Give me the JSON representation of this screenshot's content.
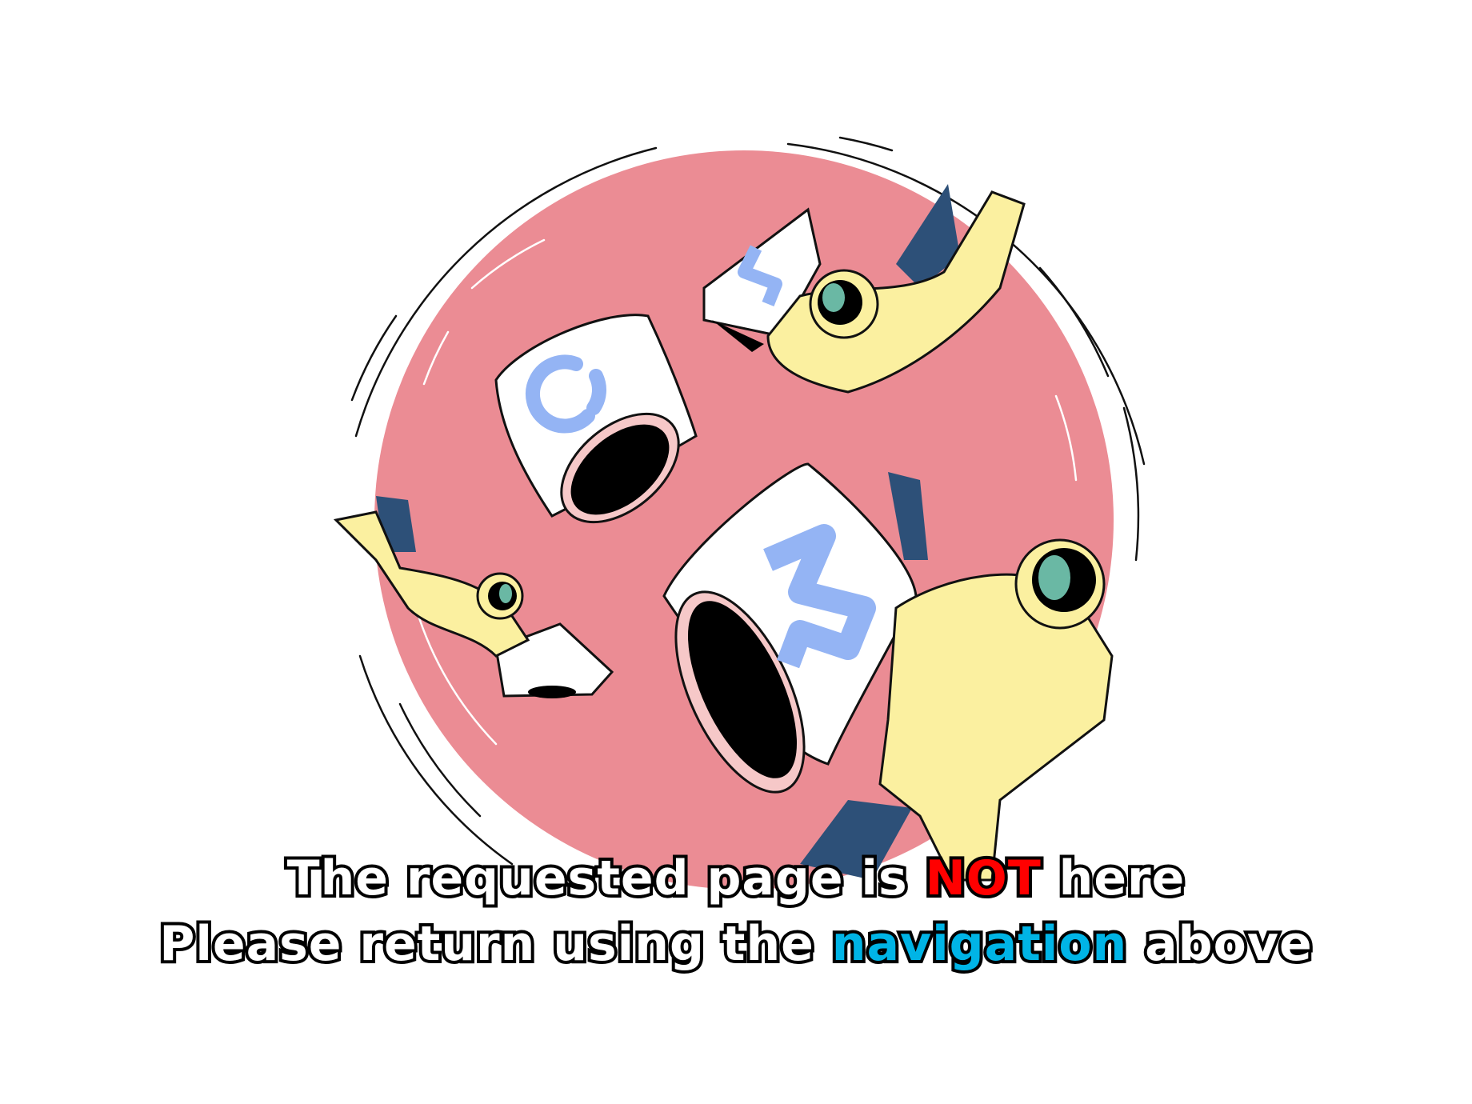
{
  "message": {
    "line1_before": "The requested page is",
    "line1_highlight": "NOT",
    "line1_after": "here",
    "line2_before": "Please return using the",
    "line2_highlight": "navigation",
    "line2_after": "above"
  },
  "colors": {
    "background": "#ffffff",
    "planet": "#eb8c94",
    "suit": "#fbf0a0",
    "suit_shadow": "#2d5078",
    "block_face": "#ffffff",
    "block_rim": "#f6c8c8",
    "digit": "#94b4f4",
    "visor": "#6ab8a4",
    "highlight_red": "#ff0000",
    "highlight_blue": "#00b4e6"
  },
  "illustration": {
    "digits": [
      "4",
      "0",
      "4"
    ],
    "icons": [
      "planet-illustration",
      "astronaut-icon",
      "404-block-icon"
    ]
  }
}
